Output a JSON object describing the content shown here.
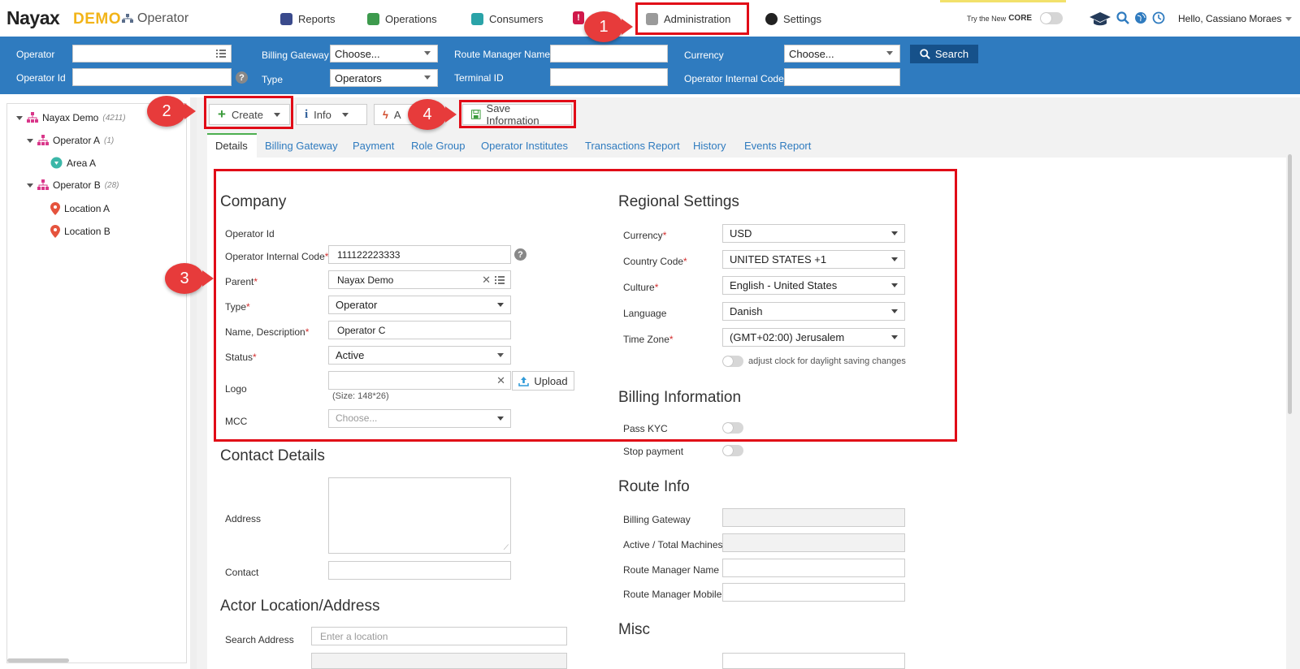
{
  "header": {
    "logo_main": "Nayax",
    "logo_demo": "DEMO",
    "section": "Operator",
    "nav": [
      {
        "label": "Reports",
        "icon": "reports-icon"
      },
      {
        "label": "Operations",
        "icon": "operations-icon"
      },
      {
        "label": "Consumers",
        "icon": "consumers-icon"
      },
      {
        "label": "Administration",
        "icon": "administration-icon"
      },
      {
        "label": "Settings",
        "icon": "settings-icon"
      }
    ],
    "try_new_core": "Try the New",
    "core_label": "CORE",
    "greeting": "Hello, Cassiano Moraes"
  },
  "filters": {
    "operator_label": "Operator",
    "operator_id_label": "Operator Id",
    "billing_gateway_label": "Billing Gateway",
    "billing_gateway_value": "Choose...",
    "type_label": "Type",
    "type_value": "Operators",
    "route_manager_label": "Route Manager Name",
    "terminal_id_label": "Terminal ID",
    "currency_label": "Currency",
    "currency_value": "Choose...",
    "operator_internal_code_label": "Operator Internal Code",
    "search_label": "Search"
  },
  "tree": [
    {
      "label": "Nayax Demo",
      "count": "(4211)"
    },
    {
      "label": "Operator A",
      "count": "(1)"
    },
    {
      "label": "Area A",
      "count": ""
    },
    {
      "label": "Operator B",
      "count": "(28)"
    },
    {
      "label": "Location A",
      "count": ""
    },
    {
      "label": "Location B",
      "count": ""
    }
  ],
  "toolbar": {
    "create": "Create",
    "info": "Info",
    "actions_partial": "A",
    "save": "Save Information"
  },
  "tabs": [
    "Details",
    "Billing Gateway",
    "Payment",
    "Role Group",
    "Operator Institutes",
    "Transactions Report",
    "History",
    "Events Report"
  ],
  "company": {
    "title": "Company",
    "operator_id_label": "Operator Id",
    "internal_code_label": "Operator Internal Code",
    "internal_code_value": "111122223333",
    "parent_label": "Parent",
    "parent_value": "Nayax Demo",
    "type_label": "Type",
    "type_value": "Operator",
    "name_label": "Name, Description",
    "name_value": "Operator C",
    "status_label": "Status",
    "status_value": "Active",
    "logo_label": "Logo",
    "upload_label": "Upload",
    "logo_size_hint": "(Size: 148*26)",
    "mcc_label": "MCC",
    "mcc_placeholder": "Choose..."
  },
  "regional": {
    "title": "Regional Settings",
    "currency_label": "Currency",
    "currency_value": "USD",
    "country_code_label": "Country Code",
    "country_code_value": "UNITED STATES +1",
    "culture_label": "Culture",
    "culture_value": "English - United States",
    "language_label": "Language",
    "language_value": "Danish",
    "timezone_label": "Time Zone",
    "timezone_value": "(GMT+02:00) Jerusalem",
    "dst_label": "adjust clock for daylight saving changes"
  },
  "billing": {
    "title": "Billing Information",
    "pass_kyc_label": "Pass KYC",
    "stop_payment_label": "Stop payment"
  },
  "contact": {
    "title": "Contact Details",
    "address_label": "Address",
    "contact_label": "Contact"
  },
  "route": {
    "title": "Route Info",
    "billing_gateway_label": "Billing Gateway",
    "active_total_label": "Active / Total Machines",
    "manager_name_label": "Route Manager Name",
    "manager_mobile_label": "Route Manager Mobile"
  },
  "actor": {
    "title": "Actor Location/Address",
    "search_label": "Search Address",
    "search_placeholder": "Enter a location"
  },
  "misc": {
    "title": "Misc"
  },
  "badges": [
    "1",
    "2",
    "3",
    "4"
  ],
  "colors": {
    "brand_blue": "#2f7bbf",
    "highlight_red": "#e10b17",
    "badge_red": "#e73b3b",
    "logo_yellow": "#f2b418"
  }
}
